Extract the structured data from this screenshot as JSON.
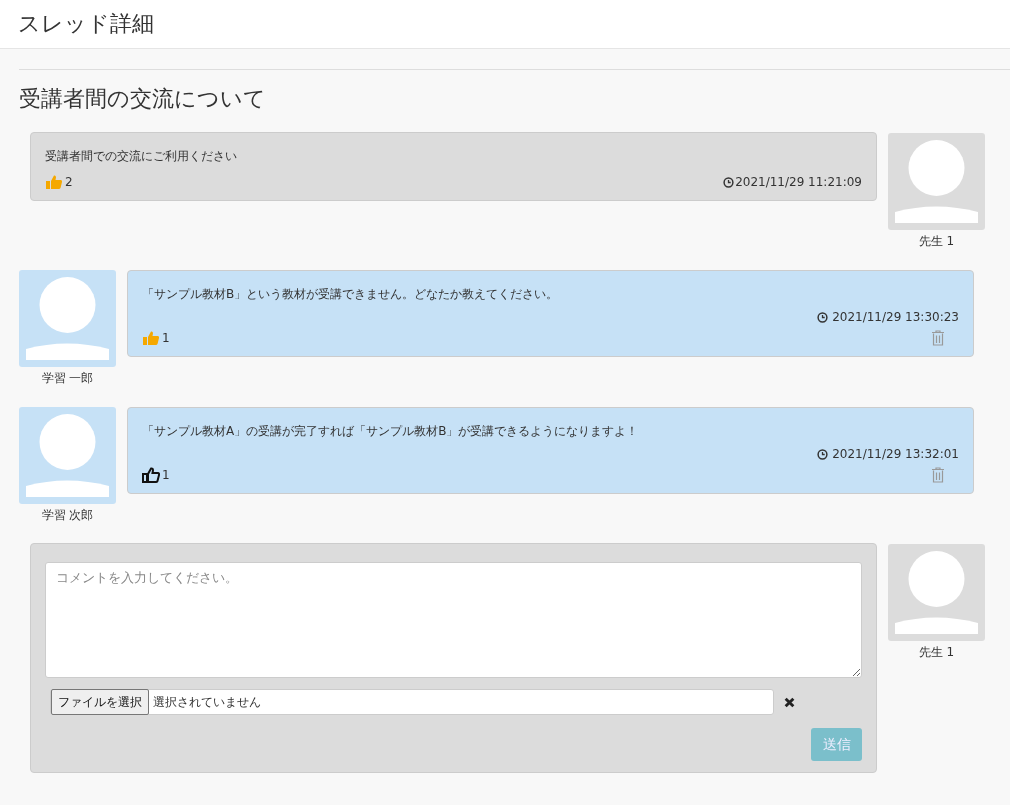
{
  "header": {
    "title": "スレッド詳細"
  },
  "thread": {
    "title": "受講者間の交流について"
  },
  "posts": [
    {
      "kind": "own",
      "body": "受講者間での交流にご利用ください",
      "liked": true,
      "likes": "2",
      "time": "2021/11/29 11:21:09",
      "deletable": false,
      "author": "先生 1"
    },
    {
      "kind": "other",
      "body": "「サンプル教材B」という教材が受講できません。どなたか教えてください。",
      "liked": true,
      "likes": "1",
      "time": "2021/11/29 13:30:23",
      "deletable": true,
      "author": "学習 一郎"
    },
    {
      "kind": "other",
      "body": "「サンプル教材A」の受講が完了すれば「サンプル教材B」が受講できるようになりますよ！",
      "liked": false,
      "likes": "1",
      "time": "2021/11/29 13:32:01",
      "deletable": true,
      "author": "学習 次郎"
    }
  ],
  "composer": {
    "placeholder": "コメントを入力してください。",
    "file_button": "ファイルを選択",
    "file_status": "選択されていません",
    "submit": "送信",
    "author": "先生 1"
  }
}
